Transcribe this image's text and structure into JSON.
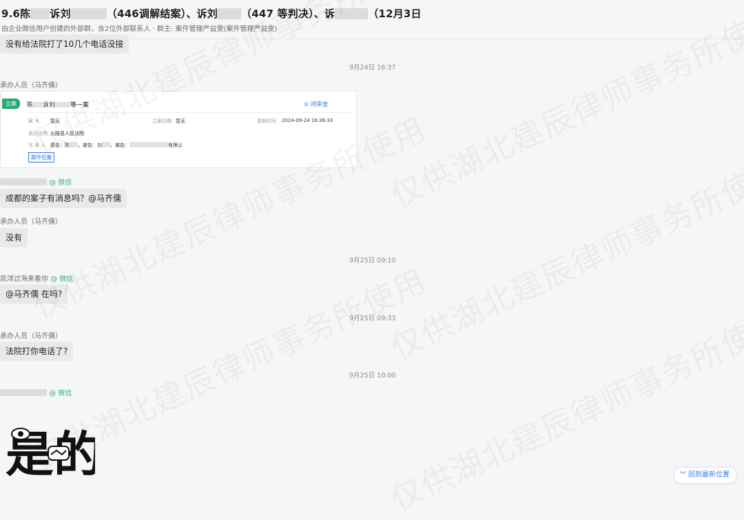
{
  "header": {
    "title_parts": [
      "9.6陈",
      "诉刘",
      "（446调解结案）、诉刘",
      "（447 等判决）、诉",
      "（12月3日"
    ],
    "subtitle": "由企业微信用户创建的外部群，含2位外部联系人 · 群主: 案件管理严益雯(案件管理严益雯)"
  },
  "messages": {
    "m1": {
      "text": "没有给法院打了10几个电话没接"
    },
    "t1": "9月24日 16:37",
    "s1": "承办人员（马齐儒）",
    "card": {
      "tag": "立案",
      "case_a": "陈",
      "case_b": "诉刘",
      "case_c": "等一案",
      "follow": "⊙ 闭审查",
      "case_no_label": "案  号",
      "case_no": "暂无",
      "filing_date_label": "立案日期",
      "filing_date": "暂无",
      "update_label": "更新时间",
      "update": "2024-09-24 16:36:33",
      "court_label": "承办法院",
      "court": "炎陵县人民法院",
      "party_label": "当 事 人",
      "party_a": "原告：陈",
      "party_b": "被告：刘",
      "party_c": "被告：",
      "party_d": "有限公",
      "button": "案件位置"
    },
    "s2_suffix": "@ 微信",
    "m2": {
      "text": "成都的案子有消息吗？@马齐儒"
    },
    "s3": "承办人员（马齐儒）",
    "m3": {
      "text": "没有"
    },
    "t2": "9月25日 09:10",
    "s4_name": "凯洋过海来看你",
    "s4_suffix": "@ 微信",
    "m4": {
      "text": "@马齐儒 在吗?"
    },
    "t3": "9月25日 09:33",
    "s5": "承办人员（马齐儒）",
    "m5": {
      "text": "法院打你电话了?"
    },
    "t4": "9月25日 10:00",
    "s6_suffix": "@ 微信"
  },
  "sticker": {
    "text": "是的",
    "icon": "handshake-icon"
  },
  "goto_latest": {
    "label": "回到最新位置",
    "icon": "double-chevron-down-icon"
  },
  "watermark": {
    "text": "仅供湖北建辰律师事务所使用"
  },
  "colors": {
    "wechat_green": "#3db36e",
    "link_blue": "#3b7bea",
    "bubble_bg": "#e8e9eb"
  }
}
